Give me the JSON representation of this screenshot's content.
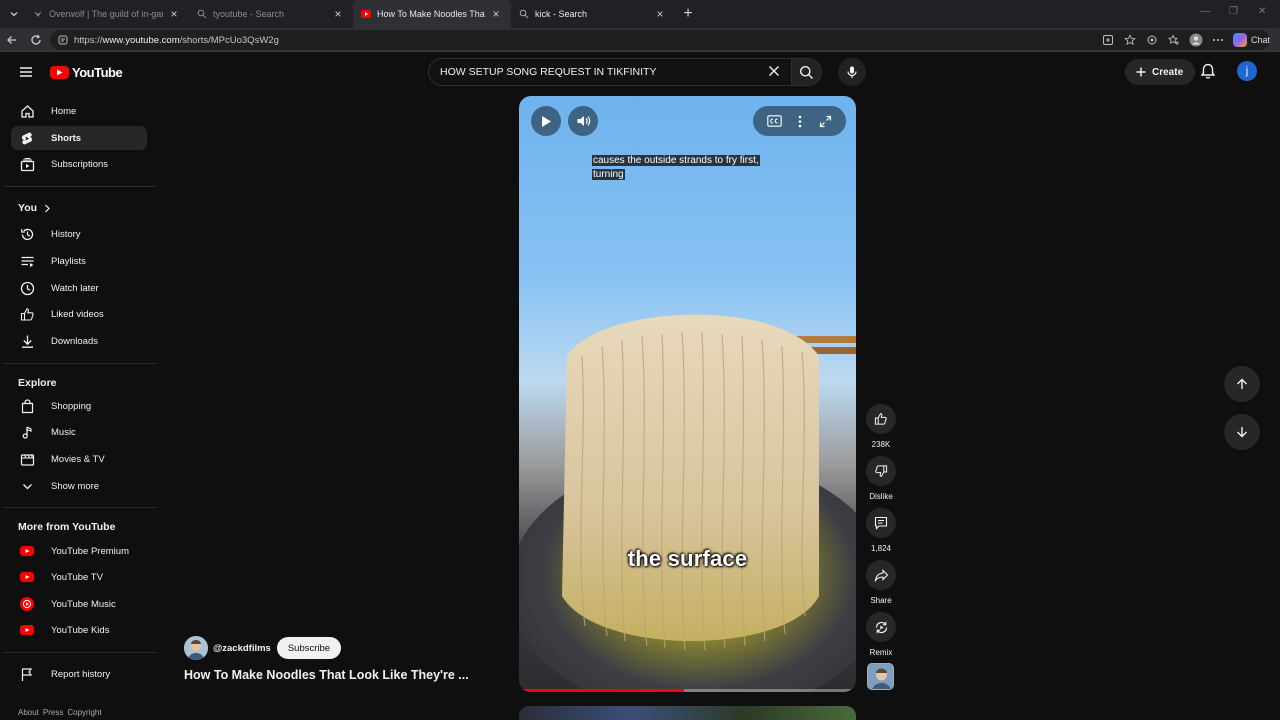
{
  "browser": {
    "tabs": [
      {
        "title": "Overwolf | The guild of in-game c",
        "active": false
      },
      {
        "title": "tyoutube - Search",
        "active": false
      },
      {
        "title": "How To Make Noodles That Look L",
        "active": true
      },
      {
        "title": "kick - Search",
        "active": false
      }
    ],
    "url_prefix": "https://",
    "url_host": "www.youtube.com",
    "url_path": "/shorts/MPcUo3QsW2g",
    "chat_label": "Chat"
  },
  "masthead": {
    "logo_text": "YouTube",
    "search_value": "HOW SETUP SONG REQUEST IN TIKFINITY",
    "create_label": "Create",
    "avatar_letter": "j"
  },
  "sidebar": {
    "main": [
      {
        "label": "Home",
        "icon": "home-icon"
      },
      {
        "label": "Shorts",
        "icon": "shorts-icon"
      },
      {
        "label": "Subscriptions",
        "icon": "subscriptions-icon"
      }
    ],
    "you_heading": "You",
    "you": [
      {
        "label": "History",
        "icon": "history-icon"
      },
      {
        "label": "Playlists",
        "icon": "playlists-icon"
      },
      {
        "label": "Watch later",
        "icon": "clock-icon"
      },
      {
        "label": "Liked videos",
        "icon": "thumbs-up-icon"
      },
      {
        "label": "Downloads",
        "icon": "download-icon"
      }
    ],
    "explore_heading": "Explore",
    "explore": [
      {
        "label": "Shopping",
        "icon": "shopping-bag-icon"
      },
      {
        "label": "Music",
        "icon": "music-note-icon"
      },
      {
        "label": "Movies & TV",
        "icon": "clapperboard-icon"
      },
      {
        "label": "Show more",
        "icon": "chevron-down-icon"
      }
    ],
    "more_heading": "More from YouTube",
    "more": [
      {
        "label": "YouTube Premium",
        "icon": "yt-premium-icon"
      },
      {
        "label": "YouTube TV",
        "icon": "yt-tv-icon"
      },
      {
        "label": "YouTube Music",
        "icon": "yt-music-icon"
      },
      {
        "label": "YouTube Kids",
        "icon": "yt-kids-icon"
      }
    ],
    "report_history": "Report history",
    "footer": [
      "About",
      "Press",
      "Copyright"
    ]
  },
  "player": {
    "caption_line1": "causes the outside strands to fry first,",
    "caption_line2": "turning",
    "burned_text": "the surface",
    "progress": 0.49
  },
  "short": {
    "channel": "@zackdfilms",
    "subscribe_label": "Subscribe",
    "title": "How To Make Noodles That Look Like They're ..."
  },
  "actions": {
    "likes": "238K",
    "dislike_label": "Dislike",
    "comments": "1,824",
    "share_label": "Share",
    "remix_label": "Remix"
  },
  "colors": {
    "accent_red": "#ff0000",
    "background": "#0f0f0f",
    "chip": "#272727"
  }
}
